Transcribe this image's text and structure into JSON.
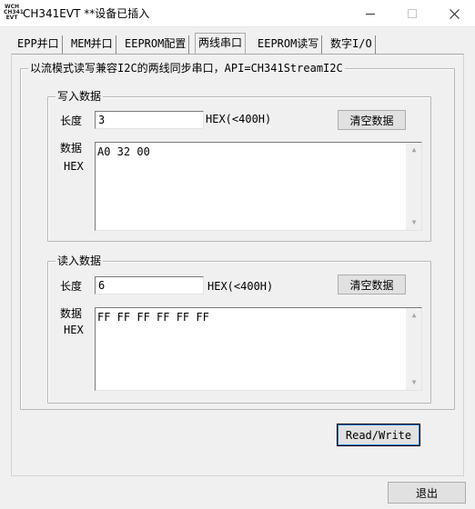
{
  "window": {
    "icon_lines": [
      "WCH",
      "CH341",
      "EVT"
    ],
    "title": "CH341EVT **设备已插入"
  },
  "tabs": [
    {
      "label": "EPP并口",
      "active": false
    },
    {
      "label": "MEM并口",
      "active": false
    },
    {
      "label": "EEPROM配置",
      "active": false
    },
    {
      "label": "两线串口",
      "active": true
    },
    {
      "label": "EEPROM读写",
      "active": false
    },
    {
      "label": "数字I/O",
      "active": false
    }
  ],
  "panel": {
    "description": "以流模式读写兼容I2C的两线同步串口，API=CH341StreamI2C"
  },
  "write_group": {
    "title": "写入数据",
    "length_label": "长度",
    "length_value": "3",
    "hex_hint": "HEX(<400H)",
    "clear_button": "清空数据",
    "data_label": "数据",
    "data_hex_label": "HEX",
    "data_value": "A0 32 00"
  },
  "read_group": {
    "title": "读入数据",
    "length_label": "长度",
    "length_value": "6",
    "hex_hint": "HEX(<400H)",
    "clear_button": "清空数据",
    "data_label": "数据",
    "data_hex_label": "HEX",
    "data_value": "FF FF FF FF FF FF"
  },
  "actions": {
    "read_write_button": "Read/Write",
    "exit_button": "退出"
  }
}
